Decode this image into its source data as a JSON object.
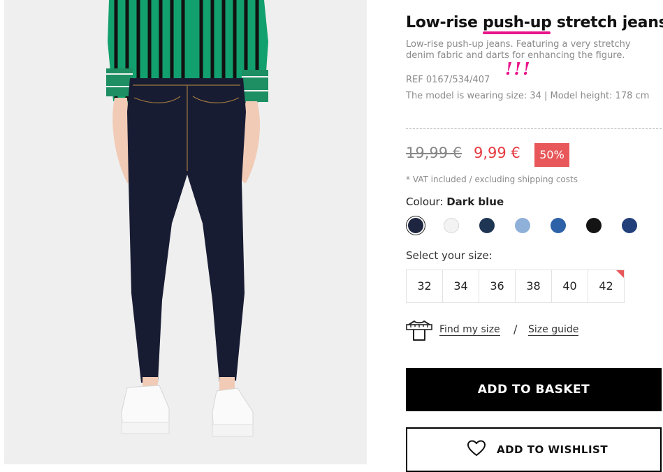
{
  "product": {
    "title_part1": "Low-rise ",
    "title_highlight": "push-up",
    "title_part2": " stretch jeans",
    "description": "Low-rise push-up jeans. Featuring a very stretchy denim fabric and darts for enhancing the figure.",
    "ref": "REF 0167/534/407",
    "annotation": "!!!",
    "model_info": "The model is wearing size: 34 | Model height: 178 cm"
  },
  "price": {
    "old": "19,99 €",
    "new": "9,99 €",
    "discount": "50%",
    "vat_note": "* VAT included / excluding shipping costs"
  },
  "colour": {
    "label": "Colour: ",
    "selected": "Dark blue",
    "swatches": [
      {
        "name": "dark-blue",
        "color": "#1d2540",
        "selected": true
      },
      {
        "name": "white",
        "color": "#f3f3f3",
        "selected": false
      },
      {
        "name": "navy",
        "color": "#1f3554",
        "selected": false
      },
      {
        "name": "light-blue",
        "color": "#8fb0d8",
        "selected": false
      },
      {
        "name": "mid-blue",
        "color": "#2e62a8",
        "selected": false
      },
      {
        "name": "black",
        "color": "#141414",
        "selected": false
      },
      {
        "name": "denim-blue",
        "color": "#223f7a",
        "selected": false
      }
    ]
  },
  "size": {
    "label": "Select your size:",
    "options": [
      "32",
      "34",
      "36",
      "38",
      "40",
      "42"
    ],
    "low_stock": "42"
  },
  "fit": {
    "find_my_size": "Find my size",
    "separator": "/",
    "size_guide": "Size guide"
  },
  "actions": {
    "add_to_basket": "ADD TO BASKET",
    "add_to_wishlist": "ADD TO WISHLIST"
  },
  "colors": {
    "accent_pink": "#e8148a",
    "sale_red": "#e53a3f",
    "badge_red": "#e8585a"
  }
}
